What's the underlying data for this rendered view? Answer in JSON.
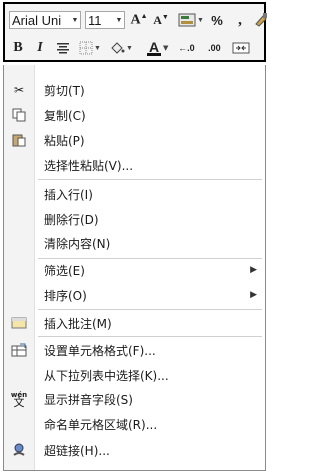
{
  "toolbar": {
    "font_name": "Arial Uni",
    "font_size": "11",
    "grow_font_icon": "A▲",
    "shrink_font_icon": "A▼",
    "percent": "%",
    "comma": ",",
    "bold": "B",
    "italic": "I",
    "font_color_letter": "A",
    "inc_decimal": "←.0",
    "dec_decimal": ".00"
  },
  "menu": {
    "items": [
      {
        "label": "剪切(T)",
        "icon": "scissors-icon"
      },
      {
        "label": "复制(C)",
        "icon": "copy-icon"
      },
      {
        "label": "粘贴(P)",
        "icon": "paste-icon"
      },
      {
        "label": "选择性粘贴(V)...",
        "icon": ""
      },
      {
        "label": "插入行(I)",
        "icon": ""
      },
      {
        "label": "删除行(D)",
        "icon": ""
      },
      {
        "label": "清除内容(N)",
        "icon": ""
      },
      {
        "label": "筛选(E)",
        "icon": "",
        "submenu": true
      },
      {
        "label": "排序(O)",
        "icon": "",
        "submenu": true
      },
      {
        "label": "插入批注(M)",
        "icon": "comment-icon"
      },
      {
        "label": "设置单元格格式(F)...",
        "icon": "format-cells-icon"
      },
      {
        "label": "从下拉列表中选择(K)...",
        "icon": ""
      },
      {
        "label": "显示拼音字段(S)",
        "icon": "phonetic-icon"
      },
      {
        "label": "命名单元格区域(R)...",
        "icon": ""
      },
      {
        "label": "超链接(H)...",
        "icon": "hyperlink-icon"
      }
    ],
    "submenu_arrow": "▶"
  }
}
